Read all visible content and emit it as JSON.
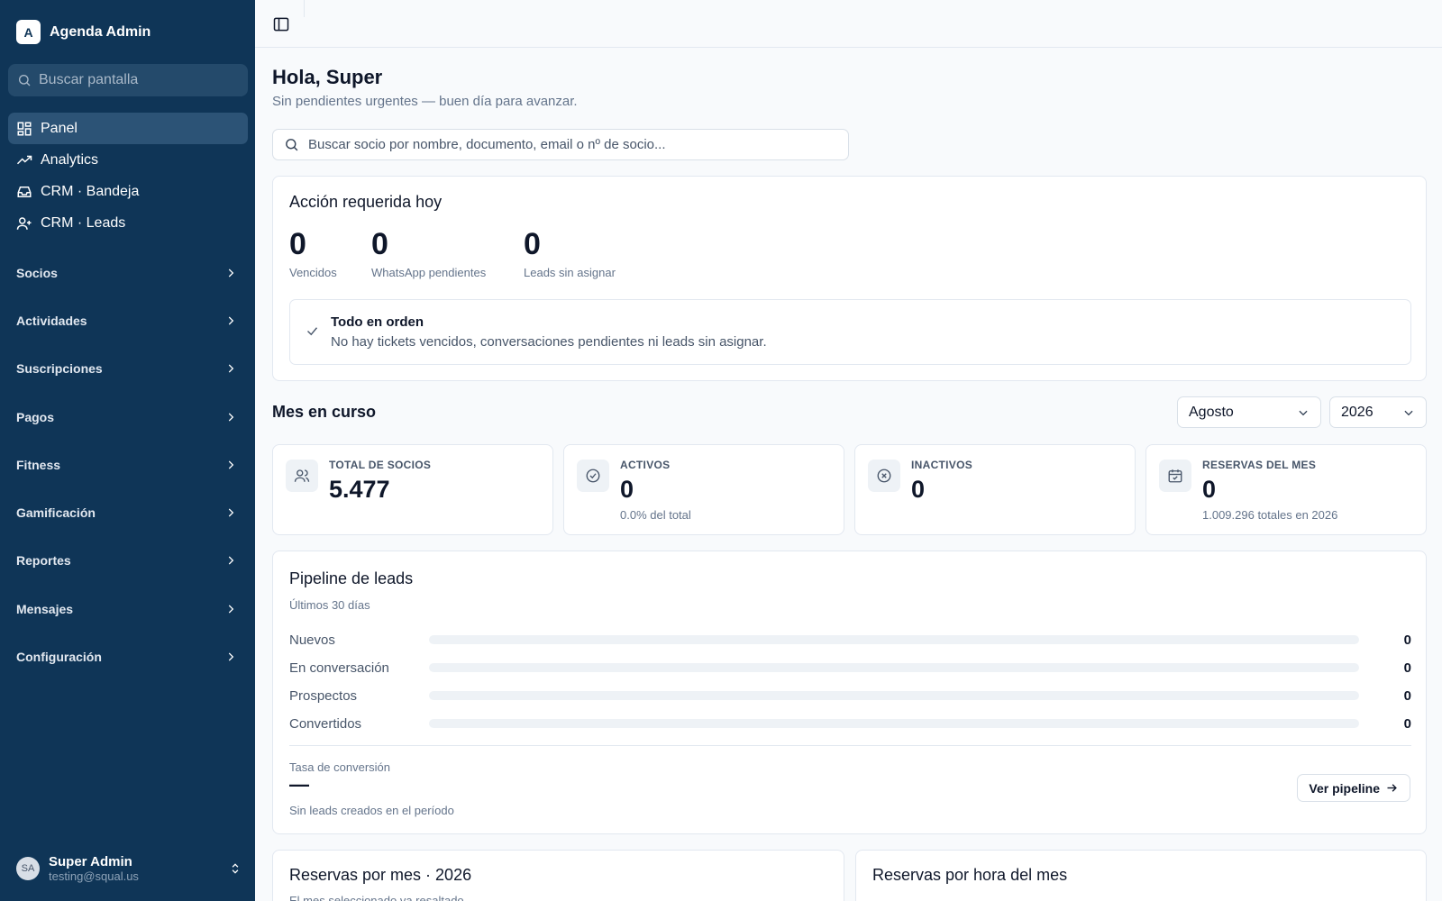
{
  "sidebar": {
    "brand_initial": "A",
    "brand_name": "Agenda Admin",
    "search_placeholder": "Buscar pantalla",
    "primary": [
      {
        "label": "Panel",
        "icon": "grid-icon"
      },
      {
        "label": "Analytics",
        "icon": "trending-up-icon"
      },
      {
        "label": "CRM · Bandeja",
        "icon": "inbox-icon"
      },
      {
        "label": "CRM · Leads",
        "icon": "user-plus-icon"
      }
    ],
    "groups": [
      "Socios",
      "Actividades",
      "Suscripciones",
      "Pagos",
      "Fitness",
      "Gamificación",
      "Reportes",
      "Mensajes",
      "Configuración"
    ],
    "user": {
      "initials": "SA",
      "name": "Super Admin",
      "email": "testing@squal.us"
    }
  },
  "main": {
    "greeting": "Hola, Super",
    "greeting_sub": "Sin pendientes urgentes — buen día para avanzar.",
    "member_search_placeholder": "Buscar socio por nombre, documento, email o nº de socio...",
    "action": {
      "title": "Acción requerida hoy",
      "stats": [
        {
          "value": "0",
          "label": "Vencidos"
        },
        {
          "value": "0",
          "label": "WhatsApp pendientes"
        },
        {
          "value": "0",
          "label": "Leads sin asignar"
        }
      ],
      "ok_title": "Todo en orden",
      "ok_desc": "No hay tickets vencidos, conversaciones pendientes ni leads sin asignar."
    },
    "month": {
      "title": "Mes en curso",
      "selected_month": "Agosto",
      "selected_year": "2026",
      "kpis": [
        {
          "label": "TOTAL DE SOCIOS",
          "value": "5.477",
          "sub": "",
          "icon": "users-icon"
        },
        {
          "label": "ACTIVOS",
          "value": "0",
          "sub": "0.0% del total",
          "icon": "check-circle-icon"
        },
        {
          "label": "INACTIVOS",
          "value": "0",
          "sub": "",
          "icon": "x-circle-icon"
        },
        {
          "label": "RESERVAS DEL MES",
          "value": "0",
          "sub": "1.009.296 totales en 2026",
          "icon": "calendar-check-icon"
        }
      ]
    },
    "pipeline": {
      "title": "Pipeline de leads",
      "subtitle": "Últimos 30 días",
      "rows": [
        {
          "label": "Nuevos",
          "value": "0",
          "fill": 0
        },
        {
          "label": "En conversación",
          "value": "0",
          "fill": 0
        },
        {
          "label": "Prospectos",
          "value": "0",
          "fill": 0
        },
        {
          "label": "Convertidos",
          "value": "0",
          "fill": 0
        }
      ],
      "conversion_label": "Tasa de conversión",
      "conversion_value": "—",
      "conversion_note": "Sin leads creados en el período",
      "button_label": "Ver pipeline"
    },
    "bottom_cards": [
      {
        "title": "Reservas por mes · 2026",
        "subtitle": "El mes seleccionado va resaltado"
      },
      {
        "title": "Reservas por hora del mes",
        "subtitle": ""
      }
    ]
  }
}
